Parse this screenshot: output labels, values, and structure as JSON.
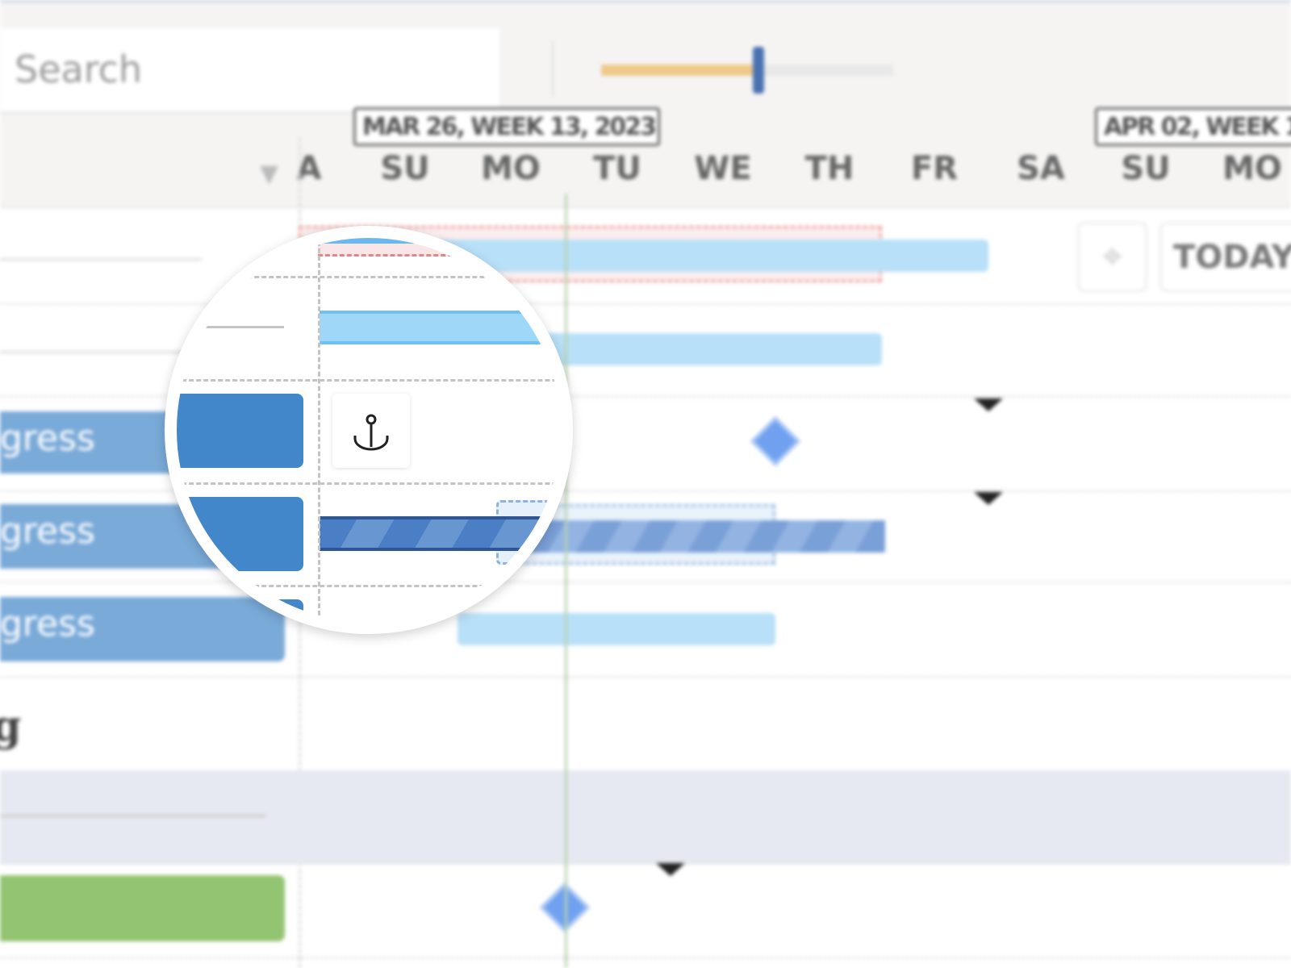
{
  "toolbar": {
    "search_placeholder": "Search",
    "zoom_slider_level": 0.55
  },
  "timeline": {
    "week_labels": [
      "MAR 26, WEEK 13, 2023",
      "APR 02, WEEK 1"
    ],
    "days": [
      "A",
      "SU",
      "MO",
      "TU",
      "WE",
      "TH",
      "FR",
      "SA",
      "SU",
      "MO"
    ]
  },
  "buttons": {
    "today": "TODAY",
    "locate_icon": "crosshair-icon"
  },
  "rows": [
    {
      "label": "gress",
      "status_color": "#7aaad8"
    },
    {
      "label": "gress",
      "status_color": "#7aaad8"
    },
    {
      "label": "gress",
      "status_color": "#7aaad8"
    },
    {
      "label": "g"
    }
  ],
  "colors": {
    "today_line": "#a8c8a0",
    "task_bar": "#b8e0f8",
    "in_progress": "#4287c9",
    "done": "#93c472",
    "milestone": "#6fa1f0"
  },
  "lens": {
    "icon": "anchor-icon"
  }
}
